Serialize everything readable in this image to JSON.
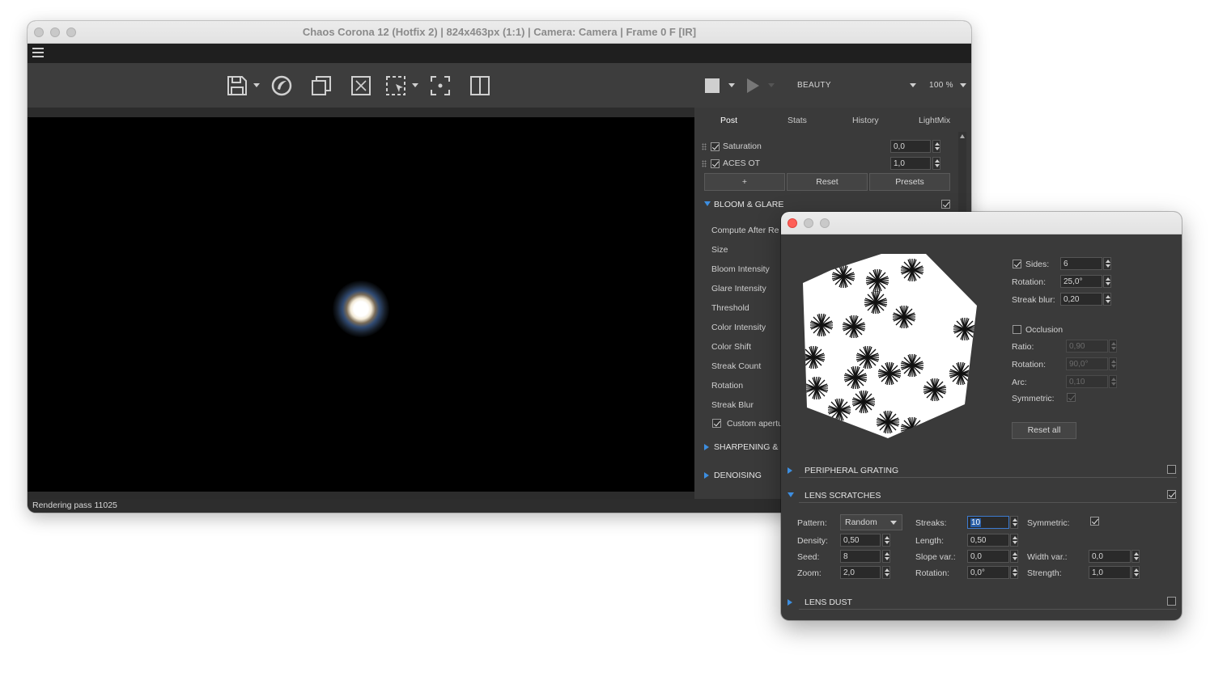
{
  "main_window": {
    "title": "Chaos Corona 12 (Hotfix 2) | 824x463px (1:1) | Camera: Camera | Frame 0 F [IR]",
    "menu_icon": "hamburger-icon",
    "toolbar": {
      "icons": [
        "save-icon",
        "corona-logo-icon",
        "copy-icon",
        "clear-icon",
        "region-select-icon",
        "focus-point-icon",
        "split-view-icon",
        "stop-icon",
        "play-icon"
      ],
      "channel": "BEAUTY",
      "zoom": "100 %"
    },
    "status": "Rendering pass 11025"
  },
  "panel": {
    "tabs": [
      "Post",
      "Stats",
      "History",
      "LightMix"
    ],
    "active_tab": "Post",
    "tonemap": [
      {
        "label": "Saturation",
        "value": "0,0",
        "checked": true
      },
      {
        "label": "ACES OT",
        "value": "1,0",
        "checked": true
      }
    ],
    "buttons": {
      "add": "+",
      "reset": "Reset",
      "presets": "Presets"
    },
    "bloom_glare": {
      "title": "BLOOM & GLARE",
      "enabled": true,
      "items": [
        "Compute After Re",
        "Size",
        "Bloom Intensity",
        "Glare Intensity",
        "Threshold",
        "Color Intensity",
        "Color Shift",
        "Streak Count",
        "Rotation",
        "Streak Blur"
      ],
      "custom_aperture": "Custom apertu",
      "custom_aperture_checked": true
    },
    "sections": [
      "SHARPENING & B",
      "DENOISING"
    ]
  },
  "aperture_window": {
    "sides": {
      "label": "Sides:",
      "value": "6",
      "checked": true
    },
    "rotation": {
      "label": "Rotation:",
      "value": "25,0°"
    },
    "streak_blur": {
      "label": "Streak blur:",
      "value": "0,20"
    },
    "occlusion": {
      "label": "Occlusion",
      "checked": false
    },
    "ratio": {
      "label": "Ratio:",
      "value": "0,90"
    },
    "occ_rotation": {
      "label": "Rotation:",
      "value": "90,0°"
    },
    "arc": {
      "label": "Arc:",
      "value": "0,10"
    },
    "symmetric": {
      "label": "Symmetric:",
      "checked": true
    },
    "reset_all": "Reset all",
    "peripheral_grating": {
      "title": "PERIPHERAL GRATING",
      "enabled": false
    },
    "lens_scratches": {
      "title": "LENS SCRATCHES",
      "enabled": true,
      "pattern": {
        "label": "Pattern:",
        "value": "Random"
      },
      "density": {
        "label": "Density:",
        "value": "0,50"
      },
      "seed": {
        "label": "Seed:",
        "value": "8"
      },
      "zoom": {
        "label": "Zoom:",
        "value": "2,0"
      },
      "streaks": {
        "label": "Streaks:",
        "value": "10"
      },
      "length": {
        "label": "Length:",
        "value": "0,50"
      },
      "slope_var": {
        "label": "Slope var.:",
        "value": "0,0"
      },
      "rotation": {
        "label": "Rotation:",
        "value": "0,0°"
      },
      "symmetric": {
        "label": "Symmetric:",
        "checked": true
      },
      "width_var": {
        "label": "Width var.:",
        "value": "0,0"
      },
      "strength": {
        "label": "Strength:",
        "value": "1,0"
      }
    },
    "lens_dust": {
      "title": "LENS DUST",
      "enabled": false
    }
  }
}
